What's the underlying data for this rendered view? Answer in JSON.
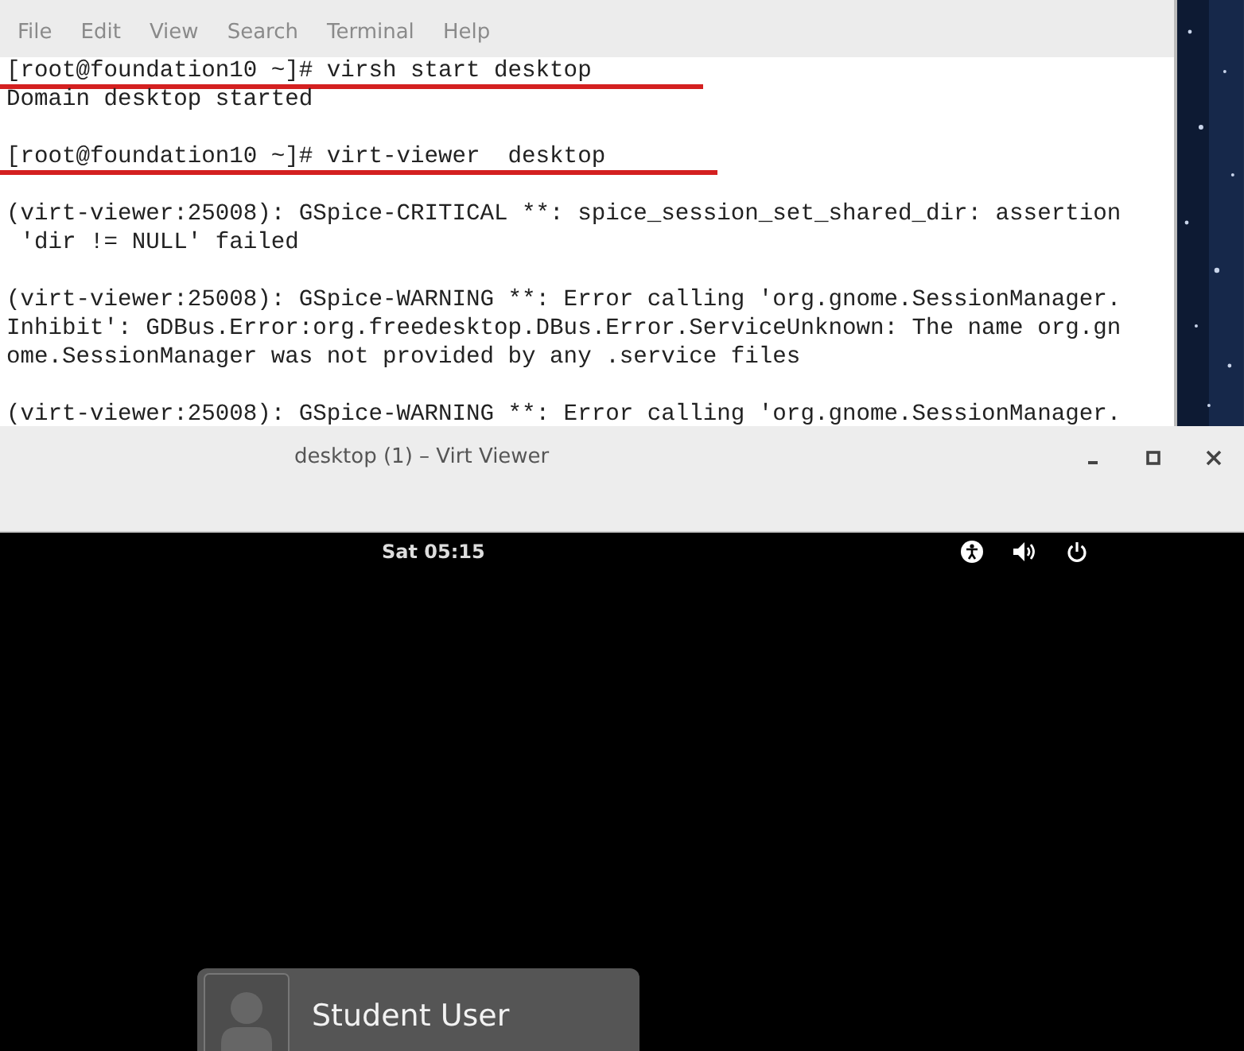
{
  "terminal": {
    "menu": [
      "File",
      "Edit",
      "View",
      "Search",
      "Terminal",
      "Help"
    ],
    "lines": [
      {
        "kind": "command",
        "text": "[root@foundation10 ~]# virsh start desktop"
      },
      {
        "kind": "output",
        "text": "Domain desktop started"
      },
      {
        "kind": "blank"
      },
      {
        "kind": "command",
        "text": "[root@foundation10 ~]# virt-viewer  desktop"
      },
      {
        "kind": "blank"
      },
      {
        "kind": "output",
        "text": "(virt-viewer:25008): GSpice-CRITICAL **: spice_session_set_shared_dir: assertion"
      },
      {
        "kind": "output",
        "text": " 'dir != NULL' failed"
      },
      {
        "kind": "blank"
      },
      {
        "kind": "output",
        "text": "(virt-viewer:25008): GSpice-WARNING **: Error calling 'org.gnome.SessionManager."
      },
      {
        "kind": "output",
        "text": "Inhibit': GDBus.Error:org.freedesktop.DBus.Error.ServiceUnknown: The name org.gn"
      },
      {
        "kind": "output",
        "text": "ome.SessionManager was not provided by any .service files"
      },
      {
        "kind": "blank"
      },
      {
        "kind": "output",
        "text": "(virt-viewer:25008): GSpice-WARNING **: Error calling 'org.gnome.SessionManager."
      }
    ]
  },
  "viewer": {
    "title": "desktop (1) – Virt Viewer",
    "guest": {
      "clock": "Sat 05:15",
      "user": {
        "name": "Student User"
      }
    }
  }
}
